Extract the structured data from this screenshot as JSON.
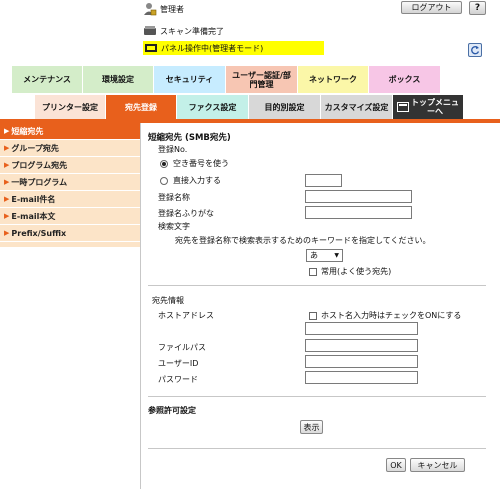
{
  "header": {
    "admin_label": "管理者",
    "logout_label": "ログアウト",
    "help_label": "?",
    "status_text": "スキャン準備完了",
    "panel_text": "パネル操作中(管理者モード)"
  },
  "main_tabs": [
    {
      "label": "メンテナンス",
      "color": "#d4edc9"
    },
    {
      "label": "環境設定",
      "color": "#d4edc9"
    },
    {
      "label": "セキュリティ",
      "color": "#c7ecff"
    },
    {
      "label_line1": "ユーザー認証/部",
      "label_line2": "門管理",
      "color": "#f7c6b3"
    },
    {
      "label": "ネットワーク",
      "color": "#fbf7a8"
    },
    {
      "label": "ボックス",
      "color": "#f7c6e6"
    }
  ],
  "sub_tabs": [
    {
      "label": "プリンター設定",
      "color": "#fbe3d6"
    },
    {
      "label": "宛先登録",
      "color": "#e8601c"
    },
    {
      "label": "ファクス設定",
      "color": "#c3f0e8"
    },
    {
      "label": "目的別設定",
      "color": "#d8d8d8"
    },
    {
      "label": "カスタマイズ設定",
      "color": "#d8d8d8"
    },
    {
      "label_line1": "トップメニュ",
      "label_line2": "ーへ",
      "color": "#333333"
    }
  ],
  "sidebar": {
    "items": [
      {
        "label": "短縮宛先"
      },
      {
        "label": "グループ宛先"
      },
      {
        "label": "プログラム宛先"
      },
      {
        "label": "一時プログラム"
      },
      {
        "label": "E-mail件名"
      },
      {
        "label": "E-mail本文"
      },
      {
        "label": "Prefix/Suffix"
      }
    ]
  },
  "form": {
    "title": "短縮宛先 (SMB宛先)",
    "reg_no_label": "登録No.",
    "radio_auto": "空き番号を使う",
    "radio_direct": "直接入力する",
    "reg_no_value": "",
    "name_label": "登録名称",
    "name_value": "",
    "furigana_label": "登録名ふりがな",
    "furigana_value": "",
    "search_label": "検索文字",
    "search_desc": "宛先を登録名称で検索表示するためのキーワードを指定してください。",
    "search_selected": "あ",
    "frequent_label": "常用(よく使う宛先)",
    "dest_info_label": "宛先情報",
    "host_label": "ホストアドレス",
    "host_check_label": "ホスト名入力時はチェックをONにする",
    "host_value": "",
    "path_label": "ファイルパス",
    "path_value": "",
    "user_label": "ユーザーID",
    "user_value": "",
    "pass_label": "パスワード",
    "pass_value": "",
    "perm_label": "参照許可設定",
    "show_button": "表示",
    "ok_button": "OK",
    "cancel_button": "キャンセル"
  }
}
